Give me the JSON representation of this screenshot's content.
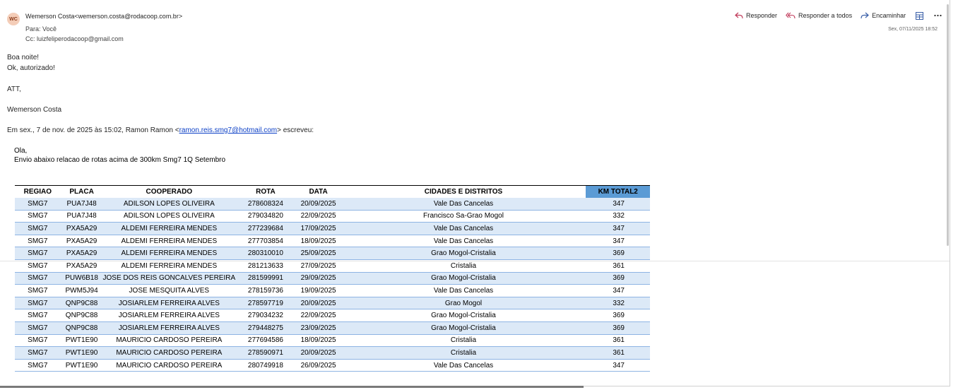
{
  "header": {
    "avatar_initials": "WC",
    "from": "Wemerson Costa<wemerson.costa@rodacoop.com.br>",
    "to": "Para: Você",
    "cc": "Cc: luizfeliperodacoop@gmail.com",
    "date": "Sex, 07/11/2025 18:52",
    "actions": {
      "reply": "Responder",
      "reply_all": "Responder a todos",
      "forward": "Encaminhar"
    }
  },
  "body": {
    "line1": "Boa noite!",
    "line2": "Ok, autorizado!",
    "att": "ATT,",
    "signature": "Wemerson Costa",
    "quote_prefix": "Em sex., 7 de nov. de 2025 às 15:02, Ramon Ramon <",
    "quote_email": "ramon.reis.smg7@hotmail.com",
    "quote_suffix": "> escreveu:"
  },
  "quoted": {
    "greeting": "Ola,",
    "message": "Envio abaixo relacao de rotas acima de 300km Smg7 1Q Setembro"
  },
  "table": {
    "headers": [
      "REGIAO",
      "PLACA",
      "COOPERADO",
      "ROTA",
      "DATA",
      "CIDADES E DISTRITOS",
      "KM TOTAL2"
    ],
    "rows": [
      [
        "SMG7",
        "PUA7J48",
        "ADILSON LOPES OLIVEIRA",
        "278608324",
        "20/09/2025",
        "Vale Das Cancelas",
        "347"
      ],
      [
        "SMG7",
        "PUA7J48",
        "ADILSON LOPES OLIVEIRA",
        "279034820",
        "22/09/2025",
        "Francisco Sa-Grao Mogol",
        "332"
      ],
      [
        "SMG7",
        "PXA5A29",
        "ALDEMI FERREIRA MENDES",
        "277239684",
        "17/09/2025",
        "Vale Das Cancelas",
        "347"
      ],
      [
        "SMG7",
        "PXA5A29",
        "ALDEMI FERREIRA MENDES",
        "277703854",
        "18/09/2025",
        "Vale Das Cancelas",
        "347"
      ],
      [
        "SMG7",
        "PXA5A29",
        "ALDEMI FERREIRA MENDES",
        "280310010",
        "25/09/2025",
        "Grao Mogol-Cristalia",
        "369"
      ],
      [
        "SMG7",
        "PXA5A29",
        "ALDEMI FERREIRA MENDES",
        "281213633",
        "27/09/2025",
        "Cristalia",
        "361"
      ],
      [
        "SMG7",
        "PUW6B18",
        "JOSE DOS REIS GONCALVES PEREIRA",
        "281599991",
        "29/09/2025",
        "Grao Mogol-Cristalia",
        "369"
      ],
      [
        "SMG7",
        "PWM5J94",
        "JOSE MESQUITA ALVES",
        "278159736",
        "19/09/2025",
        "Vale Das Cancelas",
        "347"
      ],
      [
        "SMG7",
        "QNP9C88",
        "JOSIARLEM FERREIRA ALVES",
        "278597719",
        "20/09/2025",
        "Grao Mogol",
        "332"
      ],
      [
        "SMG7",
        "QNP9C88",
        "JOSIARLEM FERREIRA ALVES",
        "279034232",
        "22/09/2025",
        "Grao Mogol-Cristalia",
        "369"
      ],
      [
        "SMG7",
        "QNP9C88",
        "JOSIARLEM FERREIRA ALVES",
        "279448275",
        "23/09/2025",
        "Grao Mogol-Cristalia",
        "369"
      ],
      [
        "SMG7",
        "PWT1E90",
        "MAURICIO CARDOSO PEREIRA",
        "277694586",
        "18/09/2025",
        "Cristalia",
        "361"
      ],
      [
        "SMG7",
        "PWT1E90",
        "MAURICIO CARDOSO PEREIRA",
        "278590971",
        "20/09/2025",
        "Cristalia",
        "361"
      ],
      [
        "SMG7",
        "PWT1E90",
        "MAURICIO CARDOSO PEREIRA",
        "280749918",
        "26/09/2025",
        "Vale Das Cancelas",
        "347"
      ]
    ]
  },
  "colors": {
    "accent": "#5b9bd5",
    "row_alt": "#dce9f7",
    "reply_icon": "#c03a5a",
    "link": "#0b3fc6"
  },
  "icons": {
    "reply": "reply-icon",
    "reply_all": "reply-all-icon",
    "forward": "forward-icon",
    "view": "grid-view-icon",
    "more": "more-icon"
  }
}
